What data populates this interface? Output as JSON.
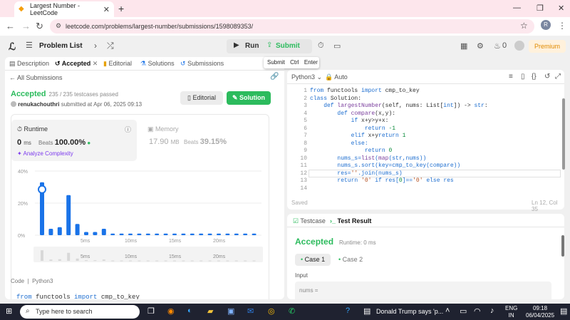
{
  "browser": {
    "tab_title": "Largest Number - LeetCode",
    "url": "leetcode.com/problems/largest-number/submissions/1598089353/",
    "profile_initial": "R"
  },
  "nav": {
    "problem_list": "Problem List",
    "run": "Run",
    "submit": "Submit",
    "fire_count": "0",
    "premium": "Premium",
    "tooltip_label": "Submit",
    "tooltip_key1": "Ctrl",
    "tooltip_key2": "Enter"
  },
  "left_tabs": [
    "Description",
    "Accepted",
    "Editorial",
    "Solutions",
    "Submissions"
  ],
  "submission": {
    "back_label": "All Submissions",
    "status": "Accepted",
    "testcases": "235 / 235 testcases passed",
    "user": "renukachouthri",
    "submitted": "submitted at Apr 06, 2025 09:13",
    "editorial_btn": "Editorial",
    "solution_btn": "Solution"
  },
  "runtime": {
    "label": "Runtime",
    "value": "0",
    "unit": "ms",
    "beats_label": "Beats",
    "beats": "100.00%",
    "analyze": "Analyze Complexity"
  },
  "memory": {
    "label": "Memory",
    "value": "17.90",
    "unit": "MB",
    "beats_label": "Beats",
    "beats": "39.15%"
  },
  "chart_data": {
    "type": "bar",
    "ylabels": [
      "40%",
      "20%",
      "0%"
    ],
    "ylim": [
      0,
      40
    ],
    "xlabels": [
      "5ms",
      "10ms",
      "15ms",
      "20ms"
    ],
    "values": [
      33,
      4,
      5,
      25,
      7,
      2,
      2,
      4,
      1,
      1,
      1,
      1,
      1,
      1,
      1,
      1,
      1,
      1,
      1,
      1,
      1,
      1,
      1,
      1,
      1
    ],
    "highlight_index": 0,
    "accent": "#1a73e8"
  },
  "code_section": {
    "label": "Code",
    "lang": "Python3",
    "preview_kw1": "from",
    "preview_mod": "functools",
    "preview_kw2": "import",
    "preview_name": "cmp_to_key"
  },
  "editor": {
    "lang": "Python3",
    "mode": "Auto",
    "saved": "Saved",
    "position": "Ln 12, Col 35",
    "line_numbers": [
      "1",
      "2",
      "3",
      "4",
      "5",
      "6",
      "7",
      "8",
      "9",
      "10",
      "11",
      "12",
      "13",
      "14"
    ]
  },
  "test": {
    "testcase_tab": "Testcase",
    "result_tab": "Test Result",
    "status": "Accepted",
    "runtime": "Runtime: 0 ms",
    "case1": "Case 1",
    "case2": "Case 2",
    "input_label": "Input",
    "input_var": "nums ="
  },
  "taskbar": {
    "search": "Type here to search",
    "news": "Donald Trump says 'p...",
    "lang1": "ENG",
    "lang2": "IN",
    "time": "09:18",
    "date": "06/04/2025"
  }
}
